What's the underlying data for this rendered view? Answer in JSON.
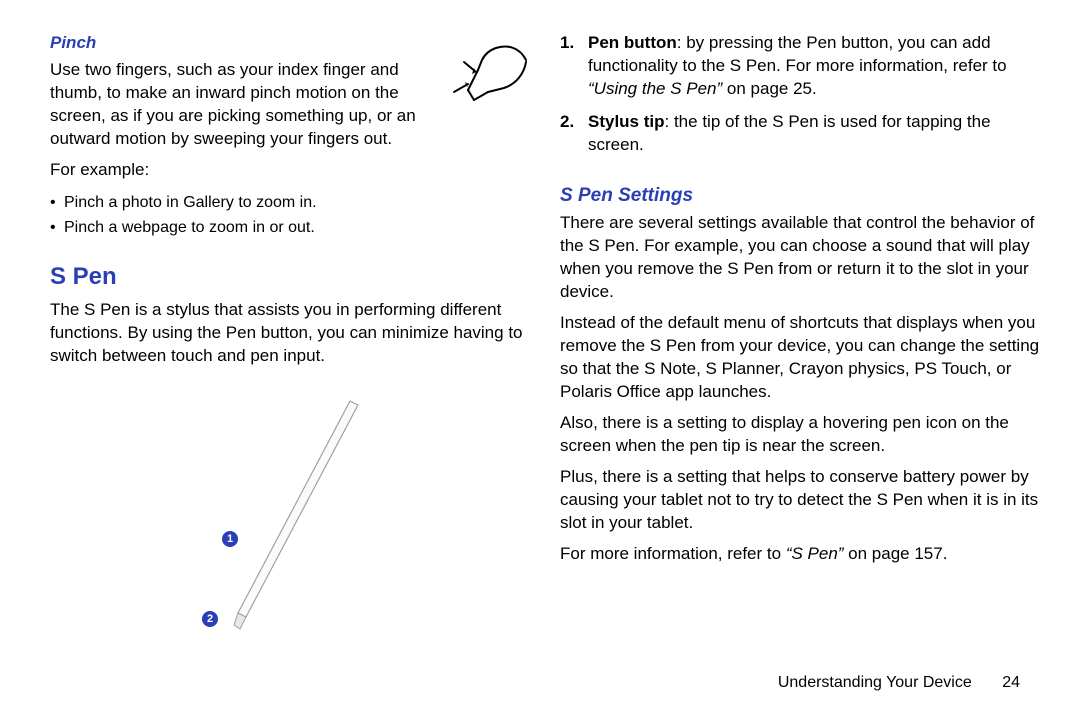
{
  "left": {
    "pinch_h": "Pinch",
    "pinch_body": "Use two fingers, such as your index finger and thumb, to make an inward pinch motion on the screen, as if you are picking something up, or an outward motion by sweeping your fingers out.",
    "for_example": "For example:",
    "bullets": {
      "0": "Pinch a photo in Gallery to zoom in.",
      "1": "Pinch a webpage to zoom in or out."
    },
    "spen_h": "S Pen",
    "spen_body": "The S Pen is a stylus that assists you in performing different functions. By using the Pen button, you can minimize having to switch between touch and pen input.",
    "callouts": {
      "0": "1",
      "1": "2"
    }
  },
  "right": {
    "items": {
      "0": {
        "num": "1.",
        "label": "Pen button",
        "body_a": ": by pressing the Pen button, you can add functionality to the S Pen. For more information, refer to ",
        "ref": "“Using the S Pen”",
        "body_b": " on page 25."
      },
      "1": {
        "num": "2.",
        "label": "Stylus tip",
        "body_a": ": the tip of the S Pen is used for tapping the screen."
      }
    },
    "settings_h": "S Pen Settings",
    "p1": "There are several settings available that control the behavior of the S Pen. For example, you can choose a sound that will play when you remove the S Pen from or return it to the slot in your device.",
    "p2": "Instead of the default menu of shortcuts that displays when you remove the S Pen from your device, you can change the setting so that the S Note, S Planner, Crayon physics, PS Touch, or Polaris Office app launches.",
    "p3": "Also, there is a setting to display a hovering pen icon on the screen when the pen tip is near the screen.",
    "p4": "Plus, there is a setting that helps to conserve battery power by causing your tablet not to try to detect the S Pen when it is in its slot in your tablet.",
    "p5a": "For more information, refer to ",
    "p5ref": "“S Pen”",
    "p5b": " on page 157."
  },
  "footer": {
    "section": "Understanding Your Device",
    "page": "24"
  }
}
